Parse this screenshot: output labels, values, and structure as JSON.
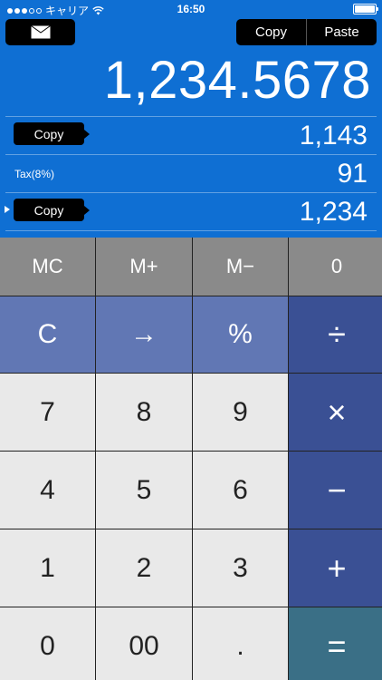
{
  "status": {
    "carrier": "キャリア",
    "time": "16:50"
  },
  "toolbar": {
    "copy_label": "Copy",
    "paste_label": "Paste"
  },
  "display": {
    "main_value": "1,234.5678"
  },
  "rows": [
    {
      "tag": "Copy",
      "value": "1,143"
    },
    {
      "label": "Tax(8%)",
      "value": "91"
    },
    {
      "tag": "Copy",
      "value": "1,234"
    }
  ],
  "keys": {
    "mc": "MC",
    "mplus": "M+",
    "mminus": "M−",
    "mem_value": "0",
    "clear": "C",
    "arrow": "→",
    "percent": "%",
    "divide": "÷",
    "k7": "7",
    "k8": "8",
    "k9": "9",
    "multiply": "×",
    "k4": "4",
    "k5": "5",
    "k6": "6",
    "minus": "−",
    "k1": "1",
    "k2": "2",
    "k3": "3",
    "plus": "+",
    "k0": "0",
    "k00": "00",
    "dot": ".",
    "equals": "="
  }
}
